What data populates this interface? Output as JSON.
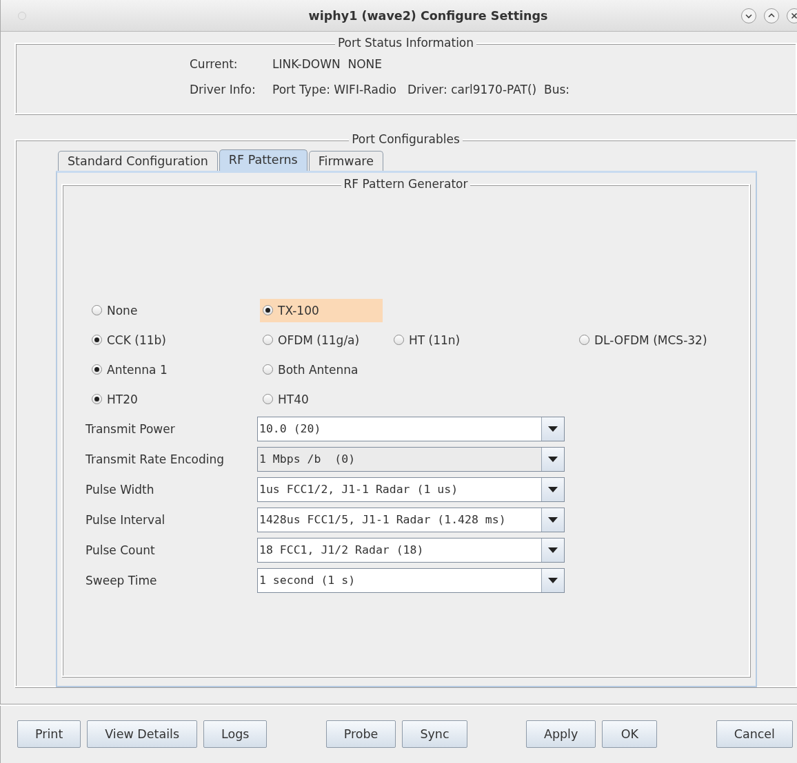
{
  "window": {
    "title": "wiphy1  (wave2) Configure Settings"
  },
  "port_status": {
    "title": "Port Status Information",
    "rows": [
      {
        "label": "Current:",
        "value": "LINK-DOWN  NONE"
      },
      {
        "label": "Driver Info:",
        "value": "Port Type: WIFI-Radio   Driver: carl9170-PAT()  Bus:"
      }
    ]
  },
  "port_configurables": {
    "title": "Port Configurables",
    "tabs": [
      {
        "label": "Standard Configuration",
        "selected": false
      },
      {
        "label": "RF Patterns",
        "selected": true
      },
      {
        "label": "Firmware",
        "selected": false
      }
    ],
    "panel_title": "RF Pattern Generator",
    "radio_rows": [
      [
        {
          "label": "None",
          "selected": false,
          "highlighted": false
        },
        {
          "label": "TX-100",
          "selected": true,
          "highlighted": true
        }
      ],
      [
        {
          "label": "CCK (11b)",
          "selected": true,
          "highlighted": false
        },
        {
          "label": "OFDM (11g/a)",
          "selected": false,
          "highlighted": false
        },
        {
          "label": "HT (11n)",
          "selected": false,
          "highlighted": false
        },
        {
          "label": "DL-OFDM (MCS-32)",
          "selected": false,
          "highlighted": false
        }
      ],
      [
        {
          "label": "Antenna 1",
          "selected": true,
          "highlighted": false
        },
        {
          "label": "Both Antenna",
          "selected": false,
          "highlighted": false
        }
      ],
      [
        {
          "label": "HT20",
          "selected": true,
          "highlighted": false
        },
        {
          "label": "HT40",
          "selected": false,
          "highlighted": false
        }
      ]
    ],
    "fields": [
      {
        "label": "Transmit Power",
        "value": "10.0 (20)",
        "editable": true
      },
      {
        "label": "Transmit Rate Encoding",
        "value": "1 Mbps /b  (0)",
        "editable": false
      },
      {
        "label": "Pulse Width",
        "value": "1us FCC1/2, J1-1 Radar (1 us)",
        "editable": true
      },
      {
        "label": "Pulse Interval",
        "value": "1428us FCC1/5, J1-1 Radar (1.428 ms)",
        "editable": true
      },
      {
        "label": "Pulse Count",
        "value": "18 FCC1, J1/2 Radar (18)",
        "editable": true
      },
      {
        "label": "Sweep Time",
        "value": "1 second (1 s)",
        "editable": true
      }
    ]
  },
  "button_groups": [
    [
      "Print",
      "View Details",
      "Logs"
    ],
    [
      "Probe",
      "Sync"
    ],
    [
      "Apply",
      "OK"
    ],
    [
      "Cancel"
    ]
  ]
}
